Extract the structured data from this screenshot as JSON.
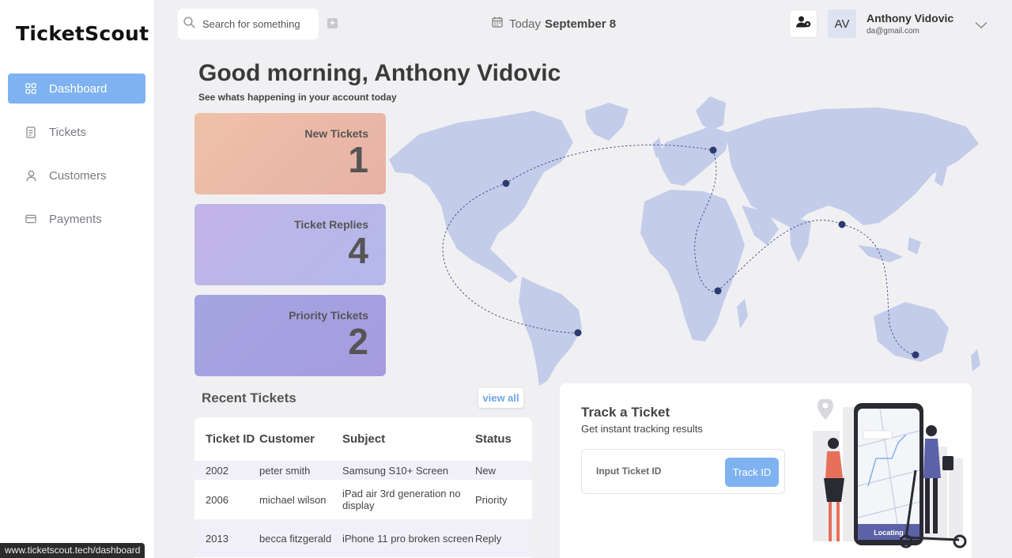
{
  "app": {
    "logo": "TicketScout"
  },
  "sidebar": {
    "items": [
      {
        "label": "Dashboard",
        "icon": "grid-icon",
        "active": true
      },
      {
        "label": "Tickets",
        "icon": "document-icon"
      },
      {
        "label": "Customers",
        "icon": "user-icon"
      },
      {
        "label": "Payments",
        "icon": "card-icon"
      }
    ]
  },
  "topbar": {
    "search_placeholder": "Search for something",
    "date_prefix": "Today",
    "date": "September 8",
    "user": {
      "initials": "AV",
      "name": "Anthony Vidovic",
      "email": "da@gmail.com"
    }
  },
  "greeting": {
    "title": "Good morning, Anthony Vidovic",
    "subtitle": "See whats happening in your account today"
  },
  "stats": [
    {
      "label": "New Tickets",
      "value": "1"
    },
    {
      "label": "Ticket Replies",
      "value": "4"
    },
    {
      "label": "Priority Tickets",
      "value": "2"
    }
  ],
  "recent": {
    "title": "Recent Tickets",
    "view_all": "view all",
    "headers": [
      "Ticket ID",
      "Customer",
      "Subject",
      "Status"
    ],
    "rows": [
      {
        "id": "2002",
        "customer": "peter smith",
        "subject": "Samsung S10+ Screen",
        "status": "New"
      },
      {
        "id": "2006",
        "customer": "michael wilson",
        "subject": "iPad air 3rd generation no display",
        "status": "Priority"
      },
      {
        "id": "2013",
        "customer": "becca fitzgerald",
        "subject": "iPhone 11 pro broken screen",
        "status": "Reply"
      }
    ]
  },
  "track": {
    "title": "Track a Ticket",
    "subtitle": "Get instant tracking results",
    "input_placeholder": "Input Ticket ID",
    "button": "Track ID",
    "illustration_label": "Locating"
  },
  "statusbar": {
    "url": "www.ticketscout.tech/dashboard"
  },
  "colors": {
    "accent": "#7fb2f0",
    "map": "#c3cdea",
    "card_new": "#efc1a8",
    "card_replies": "#c3b4e8",
    "card_priority": "#a3a6e0"
  }
}
